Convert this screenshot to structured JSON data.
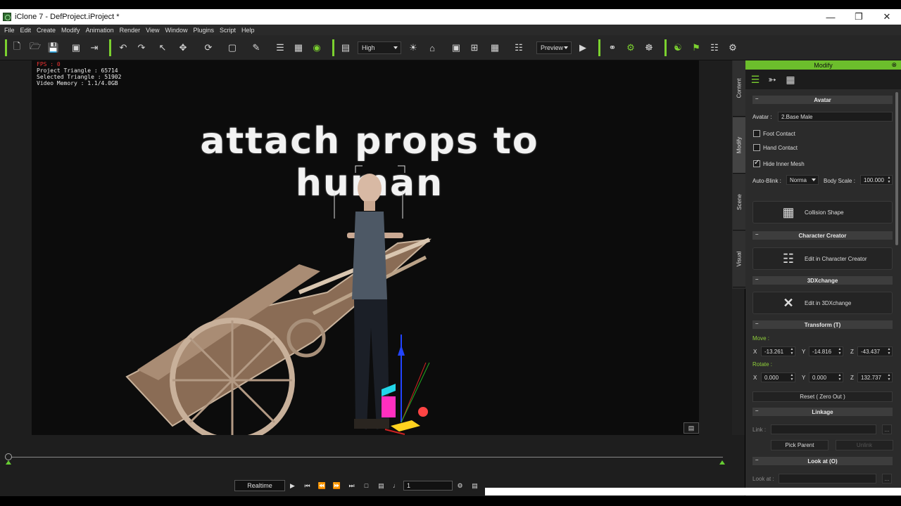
{
  "window": {
    "title": "iClone 7 - DefProject.iProject *"
  },
  "menu": [
    "File",
    "Edit",
    "Create",
    "Modify",
    "Animation",
    "Render",
    "View",
    "Window",
    "Plugins",
    "Script",
    "Help"
  ],
  "toolbar": {
    "quality": "High",
    "preview": "Preview"
  },
  "viewport": {
    "fps": "FPS : 0",
    "project_triangle": "Project Triangle : 65714",
    "selected_triangle": "Selected Triangle : 51902",
    "video_memory": "Video Memory : 1.1/4.0GB",
    "overlay_title": "attach props to human"
  },
  "playback": {
    "mode": "Realtime",
    "frame": "1"
  },
  "panel": {
    "title": "Modify",
    "tabs": [
      "Content",
      "Modify",
      "Scene",
      "Visual"
    ],
    "avatar": {
      "section": "Avatar",
      "label": "Avatar :",
      "value": "2.Base Male",
      "foot_contact": "Foot Contact",
      "hand_contact": "Hand Contact",
      "hide_inner_mesh": "Hide Inner Mesh",
      "auto_blink_label": "Auto-Blink :",
      "auto_blink_value": "Norma",
      "body_scale_label": "Body Scale :",
      "body_scale_value": "100.000",
      "collision_shape": "Collision Shape"
    },
    "character_creator": {
      "section": "Character Creator",
      "button": "Edit in Character Creator"
    },
    "dxchange": {
      "section": "3DXchange",
      "button": "Edit in 3DXchange"
    },
    "transform": {
      "section": "Transform  (T)",
      "move_label": "Move :",
      "rotate_label": "Rotate :",
      "x": "X",
      "y": "Y",
      "z": "Z",
      "move": {
        "x": "-13.261",
        "y": "-14.816",
        "z": "-43.437"
      },
      "rotate": {
        "x": "0.000",
        "y": "0.000",
        "z": "132.737"
      },
      "reset": "Reset ( Zero Out )"
    },
    "linkage": {
      "section": "Linkage",
      "link_label": "Link :",
      "pick_parent": "Pick Parent",
      "unlink": "Unlink",
      "more": "..."
    },
    "lookat": {
      "section": "Look at  (O)",
      "label": "Look at :",
      "more": "..."
    }
  }
}
